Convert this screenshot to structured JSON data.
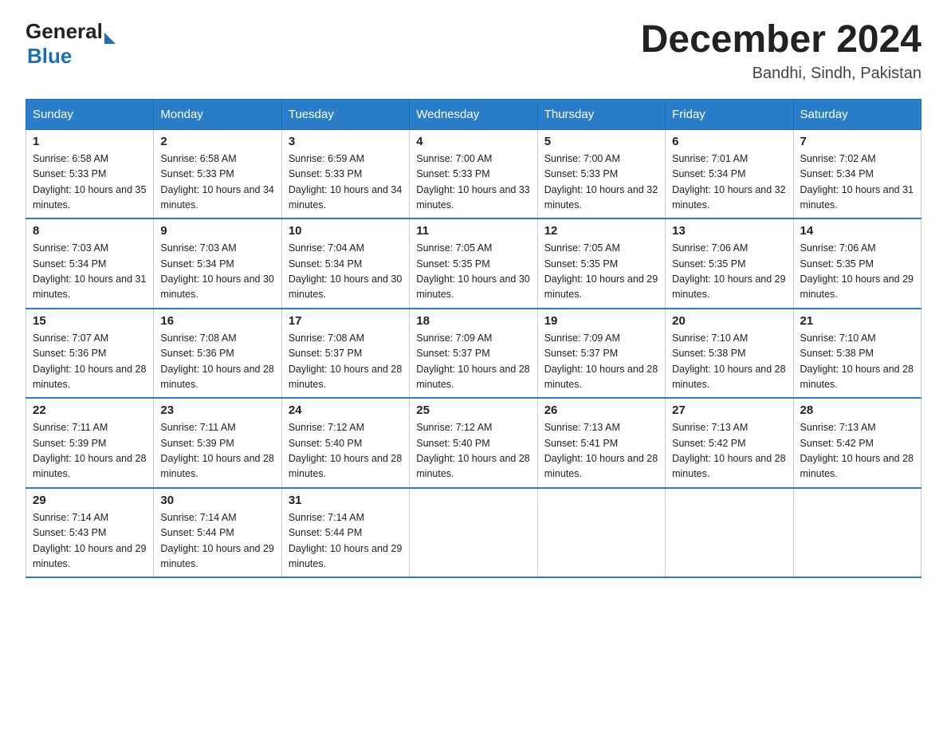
{
  "logo": {
    "general": "General",
    "blue": "Blue"
  },
  "title": "December 2024",
  "location": "Bandhi, Sindh, Pakistan",
  "days_of_week": [
    "Sunday",
    "Monday",
    "Tuesday",
    "Wednesday",
    "Thursday",
    "Friday",
    "Saturday"
  ],
  "weeks": [
    [
      {
        "day": "1",
        "sunrise": "6:58 AM",
        "sunset": "5:33 PM",
        "daylight": "10 hours and 35 minutes."
      },
      {
        "day": "2",
        "sunrise": "6:58 AM",
        "sunset": "5:33 PM",
        "daylight": "10 hours and 34 minutes."
      },
      {
        "day": "3",
        "sunrise": "6:59 AM",
        "sunset": "5:33 PM",
        "daylight": "10 hours and 34 minutes."
      },
      {
        "day": "4",
        "sunrise": "7:00 AM",
        "sunset": "5:33 PM",
        "daylight": "10 hours and 33 minutes."
      },
      {
        "day": "5",
        "sunrise": "7:00 AM",
        "sunset": "5:33 PM",
        "daylight": "10 hours and 32 minutes."
      },
      {
        "day": "6",
        "sunrise": "7:01 AM",
        "sunset": "5:34 PM",
        "daylight": "10 hours and 32 minutes."
      },
      {
        "day": "7",
        "sunrise": "7:02 AM",
        "sunset": "5:34 PM",
        "daylight": "10 hours and 31 minutes."
      }
    ],
    [
      {
        "day": "8",
        "sunrise": "7:03 AM",
        "sunset": "5:34 PM",
        "daylight": "10 hours and 31 minutes."
      },
      {
        "day": "9",
        "sunrise": "7:03 AM",
        "sunset": "5:34 PM",
        "daylight": "10 hours and 30 minutes."
      },
      {
        "day": "10",
        "sunrise": "7:04 AM",
        "sunset": "5:34 PM",
        "daylight": "10 hours and 30 minutes."
      },
      {
        "day": "11",
        "sunrise": "7:05 AM",
        "sunset": "5:35 PM",
        "daylight": "10 hours and 30 minutes."
      },
      {
        "day": "12",
        "sunrise": "7:05 AM",
        "sunset": "5:35 PM",
        "daylight": "10 hours and 29 minutes."
      },
      {
        "day": "13",
        "sunrise": "7:06 AM",
        "sunset": "5:35 PM",
        "daylight": "10 hours and 29 minutes."
      },
      {
        "day": "14",
        "sunrise": "7:06 AM",
        "sunset": "5:35 PM",
        "daylight": "10 hours and 29 minutes."
      }
    ],
    [
      {
        "day": "15",
        "sunrise": "7:07 AM",
        "sunset": "5:36 PM",
        "daylight": "10 hours and 28 minutes."
      },
      {
        "day": "16",
        "sunrise": "7:08 AM",
        "sunset": "5:36 PM",
        "daylight": "10 hours and 28 minutes."
      },
      {
        "day": "17",
        "sunrise": "7:08 AM",
        "sunset": "5:37 PM",
        "daylight": "10 hours and 28 minutes."
      },
      {
        "day": "18",
        "sunrise": "7:09 AM",
        "sunset": "5:37 PM",
        "daylight": "10 hours and 28 minutes."
      },
      {
        "day": "19",
        "sunrise": "7:09 AM",
        "sunset": "5:37 PM",
        "daylight": "10 hours and 28 minutes."
      },
      {
        "day": "20",
        "sunrise": "7:10 AM",
        "sunset": "5:38 PM",
        "daylight": "10 hours and 28 minutes."
      },
      {
        "day": "21",
        "sunrise": "7:10 AM",
        "sunset": "5:38 PM",
        "daylight": "10 hours and 28 minutes."
      }
    ],
    [
      {
        "day": "22",
        "sunrise": "7:11 AM",
        "sunset": "5:39 PM",
        "daylight": "10 hours and 28 minutes."
      },
      {
        "day": "23",
        "sunrise": "7:11 AM",
        "sunset": "5:39 PM",
        "daylight": "10 hours and 28 minutes."
      },
      {
        "day": "24",
        "sunrise": "7:12 AM",
        "sunset": "5:40 PM",
        "daylight": "10 hours and 28 minutes."
      },
      {
        "day": "25",
        "sunrise": "7:12 AM",
        "sunset": "5:40 PM",
        "daylight": "10 hours and 28 minutes."
      },
      {
        "day": "26",
        "sunrise": "7:13 AM",
        "sunset": "5:41 PM",
        "daylight": "10 hours and 28 minutes."
      },
      {
        "day": "27",
        "sunrise": "7:13 AM",
        "sunset": "5:42 PM",
        "daylight": "10 hours and 28 minutes."
      },
      {
        "day": "28",
        "sunrise": "7:13 AM",
        "sunset": "5:42 PM",
        "daylight": "10 hours and 28 minutes."
      }
    ],
    [
      {
        "day": "29",
        "sunrise": "7:14 AM",
        "sunset": "5:43 PM",
        "daylight": "10 hours and 29 minutes."
      },
      {
        "day": "30",
        "sunrise": "7:14 AM",
        "sunset": "5:44 PM",
        "daylight": "10 hours and 29 minutes."
      },
      {
        "day": "31",
        "sunrise": "7:14 AM",
        "sunset": "5:44 PM",
        "daylight": "10 hours and 29 minutes."
      },
      null,
      null,
      null,
      null
    ]
  ]
}
